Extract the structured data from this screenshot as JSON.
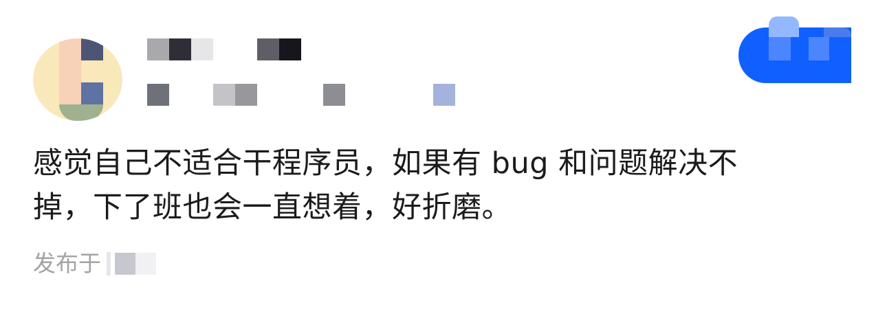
{
  "post": {
    "author": {
      "avatar_icon": "blurred-user-avatar",
      "name_redacted": true
    },
    "follow_button": {
      "label": "关注",
      "color": "#1060ff"
    },
    "body_lines": [
      "感觉自己不适合干程序员，如果有 bug 和问题解决不",
      "掉，下了班也会一直想着，好折磨。"
    ],
    "footer": {
      "published_label": "发布于",
      "published_value_redacted": true
    }
  }
}
